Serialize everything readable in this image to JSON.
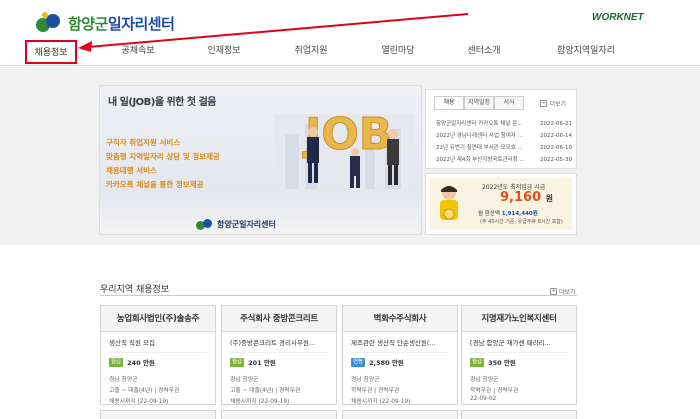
{
  "header": {
    "logo_prefix": "함양군",
    "logo_suffix": "일자리센터",
    "partner_logo": "WORKNET"
  },
  "nav": {
    "items": [
      "채용정보",
      "공채속보",
      "인재정보",
      "취업지원",
      "열린마당",
      "센터소개",
      "함양지역일자리"
    ],
    "active_index": 0
  },
  "banner": {
    "title": "내 일(JOB)을 위한 첫 걸음",
    "lines": [
      "구직자 취업지원 서비스",
      "맞춤형 지역일자리 상담 및 정보제공",
      "채용대행 서비스",
      "카카오톡 채널을 통한 정보제공"
    ],
    "footer": "함양군일자리센터",
    "art_text": "JOB"
  },
  "notice": {
    "tabs": [
      "채용",
      "지역일정",
      "서식"
    ],
    "active_tab": 0,
    "more": "더보기",
    "rows": [
      {
        "title": "함양군일자리센터 카카오톡 채널 운...",
        "date": "2022-06-21"
      },
      {
        "title": "2022년 경남나레센터 사업 참여자 ...",
        "date": "2022-06-14"
      },
      {
        "title": "22년 유번기 철연대 부서관 모모호 ...",
        "date": "2022-06-10"
      },
      {
        "title": "2022년 제4회 부산지방국토관리청 ...",
        "date": "2022-05-30"
      }
    ]
  },
  "wage": {
    "title": "2022년도 최저임금 시급",
    "value": "9,160",
    "unit": "원",
    "monthly_label": "월 환산액",
    "monthly_value": "1,914,440원",
    "note": "(주 40시간 기준, 유급주휴 8시간 포함)"
  },
  "jobs": {
    "section_title": "우리지역 채용정보",
    "more": "더보기",
    "cards": [
      {
        "company": "농업회사법인(주)솔송주",
        "subtitle": "생산직 직원 모집",
        "badge": "월급",
        "badge_color": "#7bb33a",
        "pay": "240 만원",
        "location": "경남 함양군",
        "condition": "고졸 ~ 대졸(4년) | 경력무관",
        "deadline": "채용시까지 (22-09-19)"
      },
      {
        "company": "주식회사 중방콘크리트",
        "subtitle": "(주)중방콘크리트 경리사무원...",
        "badge": "월급",
        "badge_color": "#7bb33a",
        "pay": "201 만원",
        "location": "경남 함양군",
        "condition": "고졸 ~ 대졸(4년) | 경력무관",
        "deadline": "채용시까지 (22-09-19)"
      },
      {
        "company": "벽화수주식회사",
        "subtitle": "제조관련 생산직 단순생산원(...",
        "badge": "연봉",
        "badge_color": "#3a8fd6",
        "pay": "2,580 만원",
        "location": "경남 함양군",
        "condition": "학력무관 | 경력무관",
        "deadline": "채용시까지 (22-09-19)"
      },
      {
        "company": "지명재가노인복지센터",
        "subtitle": "[경남 함양군 재가센 때리리...",
        "badge": "월급",
        "badge_color": "#7bb33a",
        "pay": "350 만원",
        "location": "경남 함양군",
        "condition": "학력무관 | 경력무관",
        "deadline": "22-09-02"
      }
    ]
  },
  "colors": {
    "brand_blue": "#1f4aa8",
    "brand_green": "#2e8b3a",
    "highlight_red": "#e3001b",
    "banner_orange": "#d98a10",
    "wage_orange": "#e1521a"
  }
}
